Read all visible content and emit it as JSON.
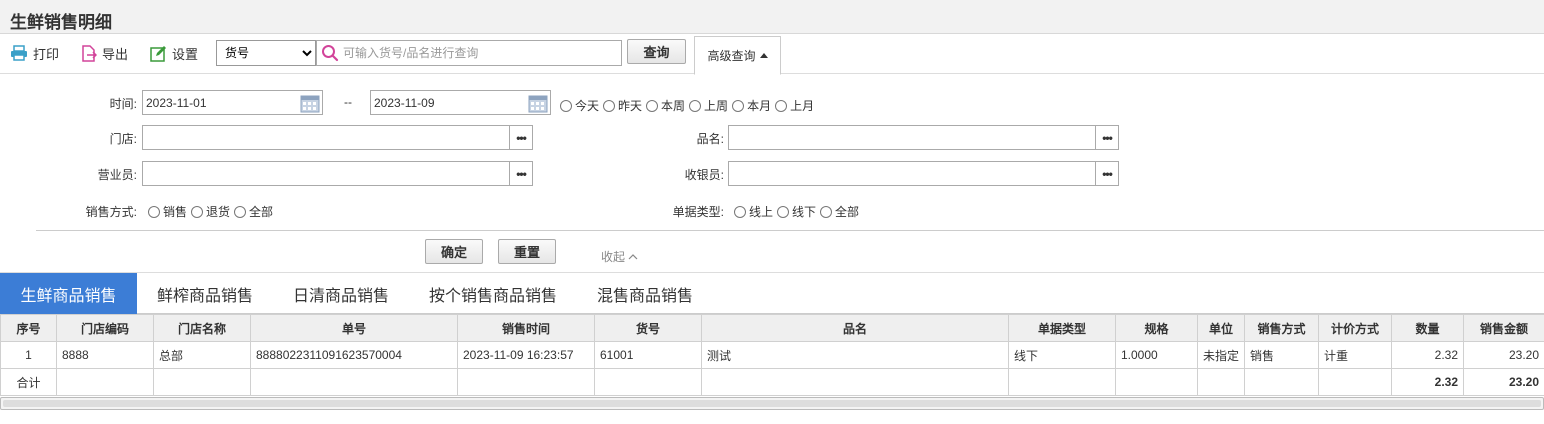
{
  "page": {
    "title": "生鲜销售明细"
  },
  "toolbar": {
    "print": "打印",
    "export": "导出",
    "settings": "设置",
    "search_field": "货号",
    "search_placeholder": "可输入货号/品名进行查询",
    "query": "查询",
    "advanced": "高级查询"
  },
  "filters": {
    "time_label": "时间:",
    "date_from": "2023-11-01",
    "date_sep": "--",
    "date_to": "2023-11-09",
    "quick_dates": [
      "今天",
      "昨天",
      "本周",
      "上周",
      "本月",
      "上月"
    ],
    "store_label": "门店:",
    "product_label": "品名:",
    "salesperson_label": "营业员:",
    "cashier_label": "收银员:",
    "sale_mode_label": "销售方式:",
    "sale_modes": [
      "销售",
      "退货",
      "全部"
    ],
    "doc_type_label": "单据类型:",
    "doc_types": [
      "线上",
      "线下",
      "全部"
    ],
    "dots": "•••",
    "confirm": "确定",
    "reset": "重置",
    "collapse": "收起"
  },
  "tabs": [
    "生鲜商品销售",
    "鲜榨商品销售",
    "日清商品销售",
    "按个销售商品销售",
    "混售商品销售"
  ],
  "table": {
    "headers": [
      "序号",
      "门店编码",
      "门店名称",
      "单号",
      "销售时间",
      "货号",
      "品名",
      "单据类型",
      "规格",
      "单位",
      "销售方式",
      "计价方式",
      "数量",
      "销售金额"
    ],
    "rows": [
      [
        "1",
        "8888",
        "总部",
        "8888022311091623570004",
        "2023-11-09 16:23:57",
        "61001",
        "测试",
        "线下",
        "1.0000",
        "未指定",
        "销售",
        "计重",
        "2.32",
        "23.20"
      ]
    ],
    "total_label": "合计",
    "total_qty": "2.32",
    "total_amount": "23.20"
  },
  "colors": {
    "accent": "#3c7dd6",
    "print_icon": "#3aa0c8",
    "export_icon": "#d2449a",
    "settings_icon": "#3a9a3a"
  }
}
